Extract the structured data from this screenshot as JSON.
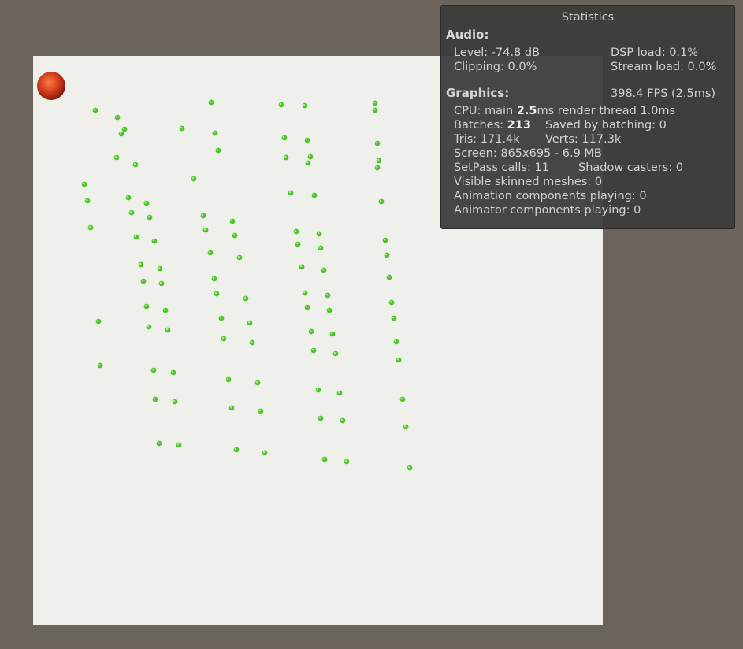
{
  "scene": {
    "colors": {
      "background": "#6a645c",
      "ground": "#efefeb",
      "pickup": "#4fc42f",
      "player": "#d23a1c"
    },
    "player_icon": "red-sphere-icon",
    "pickup_icon": "green-pickup-icon"
  },
  "stats": {
    "title": "Statistics",
    "audio": {
      "heading": "Audio:",
      "level": "Level: -74.8 dB",
      "dsp_load": "DSP load: 0.1%",
      "clipping": "Clipping: 0.0%",
      "stream_load": "Stream load: 0.0%"
    },
    "graphics": {
      "heading": "Graphics:",
      "fps": "398.4 FPS (2.5ms)",
      "cpu_prefix": "CPU: main ",
      "cpu_main": "2.5",
      "cpu_suffix": "ms  render thread 1.0ms",
      "batches_prefix": "Batches: ",
      "batches": "213",
      "saved_by_batching": "Saved by batching: 0",
      "tris": "Tris: 171.4k",
      "verts": "Verts: 117.3k",
      "screen": "Screen: 865x695 - 6.9 MB",
      "setpass": "SetPass calls: 11",
      "shadow_casters": "Shadow casters: 0",
      "visible_skinned": "Visible skinned meshes: 0",
      "animation_components": "Animation components playing: 0",
      "animator_components": "Animator components playing: 0"
    }
  }
}
